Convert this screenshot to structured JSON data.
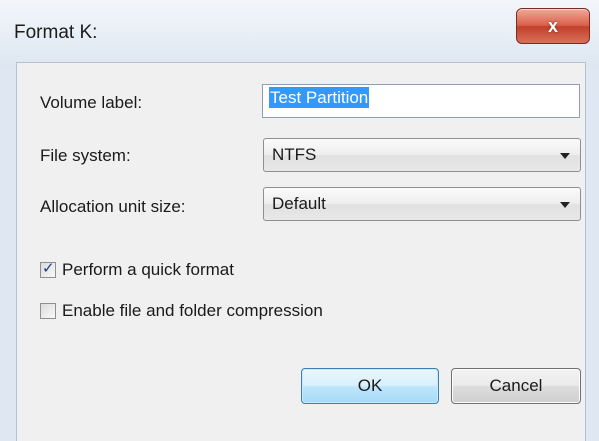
{
  "window": {
    "title": "Format K:",
    "close_symbol": "x",
    "close_icon": "close-icon"
  },
  "form": {
    "volume_label": {
      "label": "Volume label:",
      "value": "Test Partition"
    },
    "file_system": {
      "label": "File system:",
      "selected": "NTFS"
    },
    "allocation_unit_size": {
      "label": "Allocation unit size:",
      "selected": "Default"
    },
    "quick_format": {
      "label": "Perform a quick format",
      "checked": true
    },
    "compression": {
      "label": "Enable file and folder compression",
      "checked": false
    }
  },
  "buttons": {
    "ok_label": "OK",
    "cancel_label": "Cancel"
  },
  "colors": {
    "selection_highlight": "#3399ff",
    "close_button": "#c2402b",
    "default_button_border": "#3c7fb1"
  }
}
